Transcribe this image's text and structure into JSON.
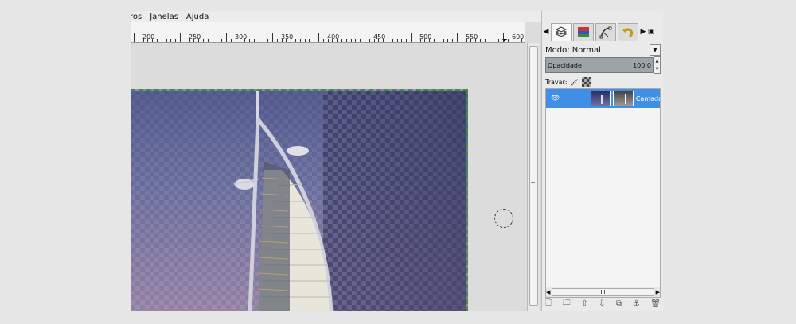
{
  "menubar": {
    "items": [
      "ros",
      "Janelas",
      "Ajuda"
    ]
  },
  "ruler": {
    "labels": [
      "200",
      "250",
      "300",
      "350",
      "400",
      "450",
      "500",
      "550",
      "600"
    ]
  },
  "dock": {
    "tab_icons": [
      "layers-icon",
      "channels-icon",
      "paths-icon",
      "undo-history-icon"
    ],
    "mode_label": "Modo: Normal",
    "opacity_label": "Opacidade",
    "opacity_value": "100,0",
    "lock_label": "Travar:",
    "layer_name": "Camada",
    "hscroll_grip": "III",
    "action_icons": [
      "new-layer-icon",
      "layer-group-icon",
      "raise-layer-icon",
      "lower-layer-icon",
      "duplicate-layer-icon",
      "anchor-icon",
      "delete-layer-icon"
    ]
  },
  "colors": {
    "selection": "#3f8fe6",
    "selection_border": "#3c8f3c"
  }
}
